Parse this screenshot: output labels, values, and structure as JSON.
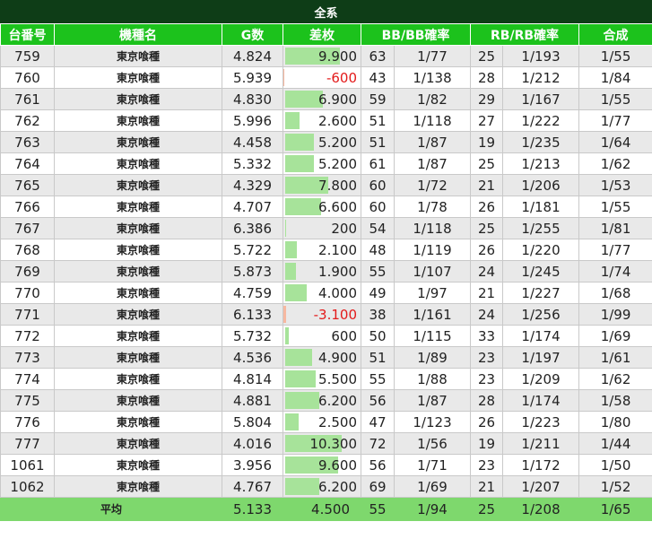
{
  "title": "全系",
  "headers": [
    "台番号",
    "機種名",
    "G数",
    "差枚",
    "BB/BB確率",
    "RB/RB確率",
    "合成"
  ],
  "rows": [
    {
      "id": "759",
      "name": "東京喰種",
      "g": "4.824",
      "diff": "9.900",
      "diff_num": 9900,
      "bb": "63",
      "bbp": "1/77",
      "rb": "25",
      "rbp": "1/193",
      "syn": "1/55"
    },
    {
      "id": "760",
      "name": "東京喰種",
      "g": "5.939",
      "diff": "-600",
      "diff_num": -600,
      "bb": "43",
      "bbp": "1/138",
      "rb": "28",
      "rbp": "1/212",
      "syn": "1/84"
    },
    {
      "id": "761",
      "name": "東京喰種",
      "g": "4.830",
      "diff": "6.900",
      "diff_num": 6900,
      "bb": "59",
      "bbp": "1/82",
      "rb": "29",
      "rbp": "1/167",
      "syn": "1/55"
    },
    {
      "id": "762",
      "name": "東京喰種",
      "g": "5.996",
      "diff": "2.600",
      "diff_num": 2600,
      "bb": "51",
      "bbp": "1/118",
      "rb": "27",
      "rbp": "1/222",
      "syn": "1/77"
    },
    {
      "id": "763",
      "name": "東京喰種",
      "g": "4.458",
      "diff": "5.200",
      "diff_num": 5200,
      "bb": "51",
      "bbp": "1/87",
      "rb": "19",
      "rbp": "1/235",
      "syn": "1/64"
    },
    {
      "id": "764",
      "name": "東京喰種",
      "g": "5.332",
      "diff": "5.200",
      "diff_num": 5200,
      "bb": "61",
      "bbp": "1/87",
      "rb": "25",
      "rbp": "1/213",
      "syn": "1/62"
    },
    {
      "id": "765",
      "name": "東京喰種",
      "g": "4.329",
      "diff": "7.800",
      "diff_num": 7800,
      "bb": "60",
      "bbp": "1/72",
      "rb": "21",
      "rbp": "1/206",
      "syn": "1/53"
    },
    {
      "id": "766",
      "name": "東京喰種",
      "g": "4.707",
      "diff": "6.600",
      "diff_num": 6600,
      "bb": "60",
      "bbp": "1/78",
      "rb": "26",
      "rbp": "1/181",
      "syn": "1/55"
    },
    {
      "id": "767",
      "name": "東京喰種",
      "g": "6.386",
      "diff": "200",
      "diff_num": 200,
      "bb": "54",
      "bbp": "1/118",
      "rb": "25",
      "rbp": "1/255",
      "syn": "1/81"
    },
    {
      "id": "768",
      "name": "東京喰種",
      "g": "5.722",
      "diff": "2.100",
      "diff_num": 2100,
      "bb": "48",
      "bbp": "1/119",
      "rb": "26",
      "rbp": "1/220",
      "syn": "1/77"
    },
    {
      "id": "769",
      "name": "東京喰種",
      "g": "5.873",
      "diff": "1.900",
      "diff_num": 1900,
      "bb": "55",
      "bbp": "1/107",
      "rb": "24",
      "rbp": "1/245",
      "syn": "1/74"
    },
    {
      "id": "770",
      "name": "東京喰種",
      "g": "4.759",
      "diff": "4.000",
      "diff_num": 4000,
      "bb": "49",
      "bbp": "1/97",
      "rb": "21",
      "rbp": "1/227",
      "syn": "1/68"
    },
    {
      "id": "771",
      "name": "東京喰種",
      "g": "6.133",
      "diff": "-3.100",
      "diff_num": -3100,
      "bb": "38",
      "bbp": "1/161",
      "rb": "24",
      "rbp": "1/256",
      "syn": "1/99"
    },
    {
      "id": "772",
      "name": "東京喰種",
      "g": "5.732",
      "diff": "600",
      "diff_num": 600,
      "bb": "50",
      "bbp": "1/115",
      "rb": "33",
      "rbp": "1/174",
      "syn": "1/69"
    },
    {
      "id": "773",
      "name": "東京喰種",
      "g": "4.536",
      "diff": "4.900",
      "diff_num": 4900,
      "bb": "51",
      "bbp": "1/89",
      "rb": "23",
      "rbp": "1/197",
      "syn": "1/61"
    },
    {
      "id": "774",
      "name": "東京喰種",
      "g": "4.814",
      "diff": "5.500",
      "diff_num": 5500,
      "bb": "55",
      "bbp": "1/88",
      "rb": "23",
      "rbp": "1/209",
      "syn": "1/62"
    },
    {
      "id": "775",
      "name": "東京喰種",
      "g": "4.881",
      "diff": "6.200",
      "diff_num": 6200,
      "bb": "56",
      "bbp": "1/87",
      "rb": "28",
      "rbp": "1/174",
      "syn": "1/58"
    },
    {
      "id": "776",
      "name": "東京喰種",
      "g": "5.804",
      "diff": "2.500",
      "diff_num": 2500,
      "bb": "47",
      "bbp": "1/123",
      "rb": "26",
      "rbp": "1/223",
      "syn": "1/80"
    },
    {
      "id": "777",
      "name": "東京喰種",
      "g": "4.016",
      "diff": "10.300",
      "diff_num": 10300,
      "bb": "72",
      "bbp": "1/56",
      "rb": "19",
      "rbp": "1/211",
      "syn": "1/44"
    },
    {
      "id": "1061",
      "name": "東京喰種",
      "g": "3.956",
      "diff": "9.600",
      "diff_num": 9600,
      "bb": "56",
      "bbp": "1/71",
      "rb": "23",
      "rbp": "1/172",
      "syn": "1/50"
    },
    {
      "id": "1062",
      "name": "東京喰種",
      "g": "4.767",
      "diff": "6.200",
      "diff_num": 6200,
      "bb": "69",
      "bbp": "1/69",
      "rb": "21",
      "rbp": "1/207",
      "syn": "1/52"
    }
  ],
  "footer": {
    "label": "平均",
    "g": "5.133",
    "diff": "4.500",
    "bb": "55",
    "bbp": "1/94",
    "rb": "25",
    "rbp": "1/208",
    "syn": "1/65"
  },
  "colors": {
    "title_bg": "#0e3d17",
    "header_bg": "#1cc21c",
    "footer_bg": "#7ed86d",
    "positive_bar": "#a7e39a",
    "negative_bar": "#f7b8a0",
    "negative_text": "#e31a1a"
  }
}
